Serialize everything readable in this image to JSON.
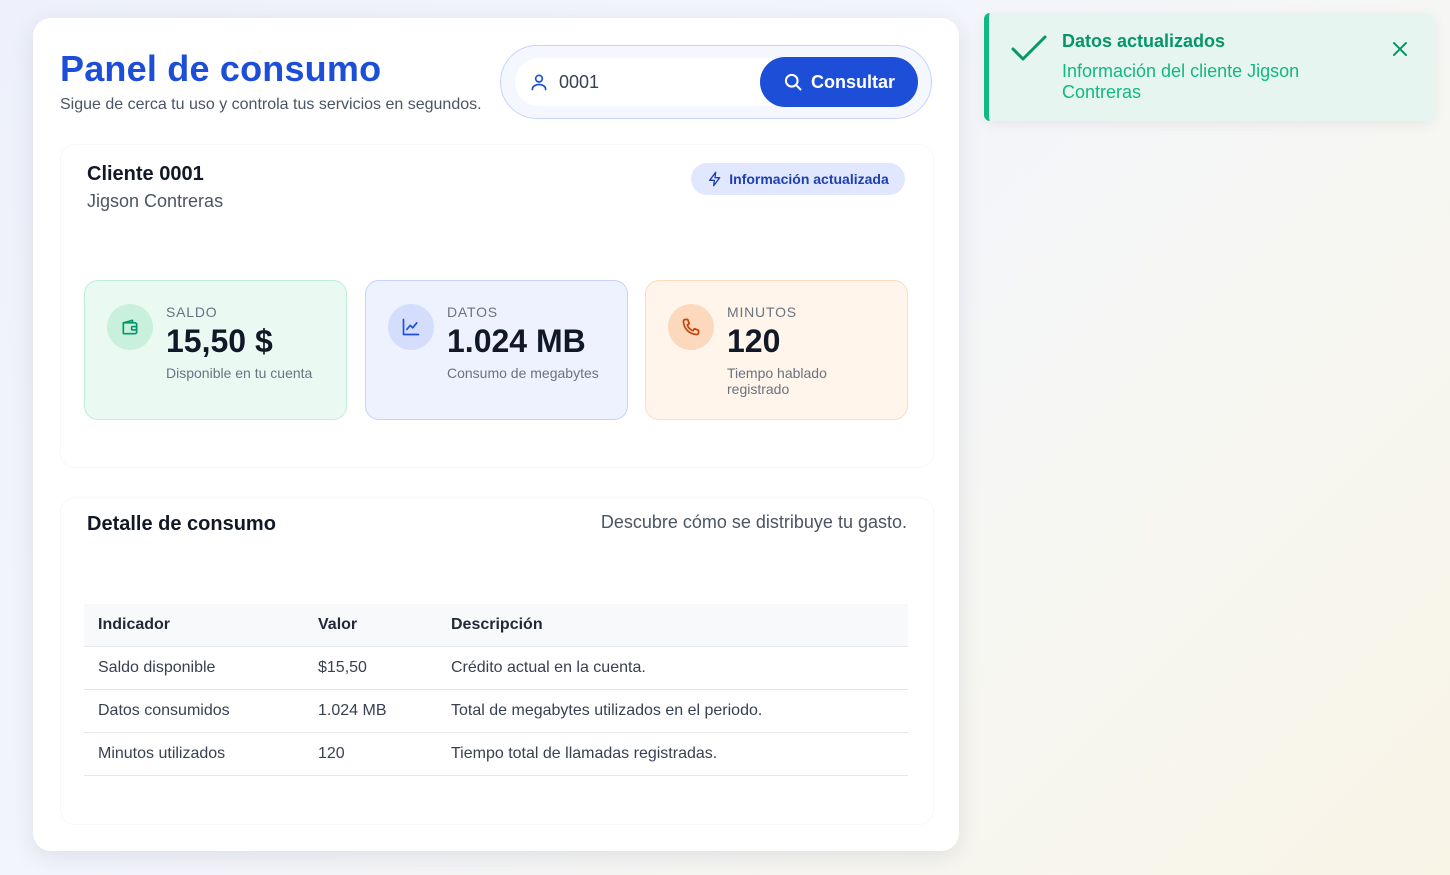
{
  "header": {
    "title": "Panel de consumo",
    "subtitle": "Sigue de cerca tu uso y controla tus servicios en segundos."
  },
  "search": {
    "value": "0001",
    "button_label": "Consultar"
  },
  "client": {
    "id_label": "Cliente 0001",
    "name": "Jigson Contreras",
    "badge": "Información actualizada"
  },
  "stats": [
    {
      "label": "SALDO",
      "value": "15,50 $",
      "description": "Disponible en tu cuenta",
      "icon": "wallet-icon",
      "color": "#059669"
    },
    {
      "label": "DATOS",
      "value": "1.024 MB",
      "description": "Consumo de megabytes",
      "icon": "chart-line-icon",
      "color": "#1d4ed8"
    },
    {
      "label": "MINUTOS",
      "value": "120",
      "description": "Tiempo hablado registrado",
      "icon": "phone-icon",
      "color": "#c2410c"
    }
  ],
  "detail": {
    "title": "Detalle de consumo",
    "subtitle": "Descubre cómo se distribuye tu gasto.",
    "columns": [
      "Indicador",
      "Valor",
      "Descripción"
    ],
    "rows": [
      [
        "Saldo disponible",
        "$15,50",
        "Crédito actual en la cuenta."
      ],
      [
        "Datos consumidos",
        "1.024 MB",
        "Total de megabytes utilizados en el periodo."
      ],
      [
        "Minutos utilizados",
        "120",
        "Tiempo total de llamadas registradas."
      ]
    ]
  },
  "toast": {
    "title": "Datos actualizados",
    "message": "Información del cliente Jigson Contreras",
    "accent": "#10b981"
  }
}
